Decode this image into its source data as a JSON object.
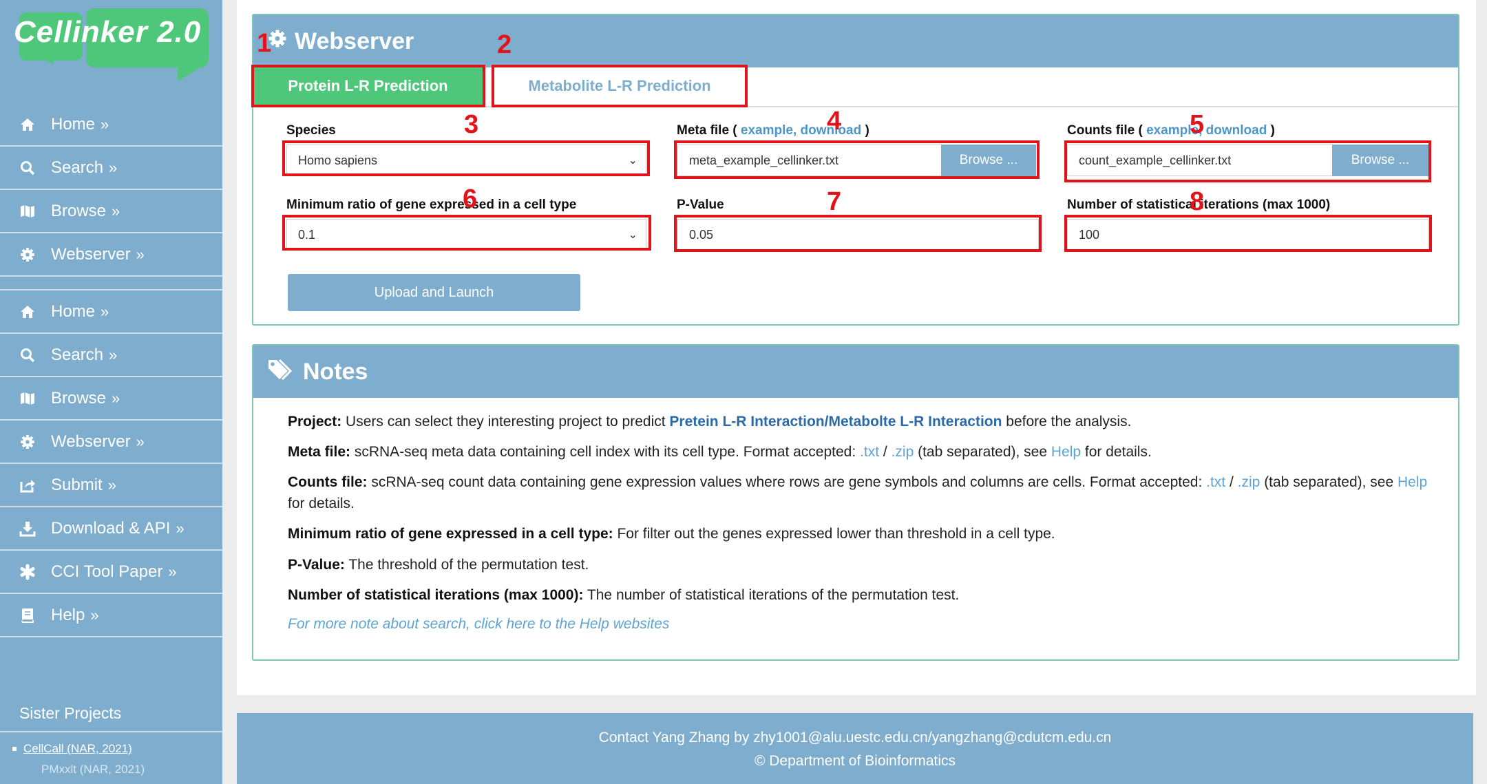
{
  "logo": {
    "text": "Cellinker 2.0"
  },
  "nav": [
    {
      "label": "Home",
      "icon": "home-icon"
    },
    {
      "label": "Search",
      "icon": "search-icon"
    },
    {
      "label": "Browse",
      "icon": "map-icon"
    },
    {
      "label": "Webserver",
      "icon": "gear-icon"
    },
    {
      "label": "Home",
      "icon": "home-icon"
    },
    {
      "label": "Search",
      "icon": "search-icon"
    },
    {
      "label": "Browse",
      "icon": "map-icon"
    },
    {
      "label": "Webserver",
      "icon": "gear-icon"
    },
    {
      "label": "Submit",
      "icon": "share-icon"
    },
    {
      "label": "Download & API",
      "icon": "download-icon"
    },
    {
      "label": "CCI Tool Paper",
      "icon": "asterisk-icon"
    },
    {
      "label": "Help",
      "icon": "book-icon"
    }
  ],
  "nav_chevron": "»",
  "sister": {
    "title": "Sister Projects",
    "link": "CellCall (NAR, 2021)",
    "cut": "PMxxlt (NAR, 2021)"
  },
  "webserver": {
    "title": "Webserver",
    "tabs": {
      "protein": "Protein L-R Prediction",
      "metabolite": "Metabolite L-R Prediction"
    },
    "species": {
      "label": "Species",
      "value": "Homo sapiens"
    },
    "meta": {
      "label": "Meta file (",
      "example": "example,",
      "download": "download",
      "close": ")",
      "value": "meta_example_cellinker.txt",
      "browse": "Browse ..."
    },
    "counts": {
      "label": "Counts file (",
      "example": "example,",
      "download": "download",
      "close": ")",
      "value": "count_example_cellinker.txt",
      "browse": "Browse ..."
    },
    "min_ratio": {
      "label": "Minimum ratio of gene expressed in a cell type",
      "value": "0.1"
    },
    "pvalue": {
      "label": "P-Value",
      "value": "0.05"
    },
    "iterations": {
      "label": "Number of statistical iterations (max 1000)",
      "value": "100"
    },
    "launch": "Upload and Launch"
  },
  "annotations": [
    "1",
    "2",
    "3",
    "4",
    "5",
    "6",
    "7",
    "8"
  ],
  "annotation_color": "#e1141c",
  "notes": {
    "title": "Notes",
    "project": {
      "k": "Project:",
      "t1": " Users can select they interesting project to predict ",
      "hl": "Pretein L-R Interaction/Metabolte L-R Interaction",
      "t2": " before the analysis."
    },
    "meta": {
      "k": "Meta file:",
      "t1": " scRNA-seq meta data containing cell index with its cell type. Format accepted: ",
      "txt": ".txt",
      "sep": " / ",
      "zip": ".zip",
      "t2": " (tab separated), see ",
      "help": "Help",
      "t3": " for details."
    },
    "counts": {
      "k": "Counts file:",
      "t1": " scRNA-seq count data containing gene expression values where rows are gene symbols and columns are cells. Format accepted: ",
      "txt": ".txt",
      "sep": " / ",
      "zip": ".zip",
      "t2": " (tab separated), see ",
      "help": "Help",
      "t3": " for details."
    },
    "minratio": {
      "k": "Minimum ratio of gene expressed in a cell type:",
      "t": " For filter out the genes expressed lower than threshold in a cell type."
    },
    "pvalue": {
      "k": "P-Value:",
      "t": " The threshold of the permutation test."
    },
    "iter": {
      "k": "Number of statistical iterations (max 1000):",
      "t": " The number of statistical iterations of the permutation test."
    },
    "more": "For more note about search, click here to the Help websites"
  },
  "footer": {
    "line1": "Contact Yang Zhang by  zhy1001@alu.uestc.edu.cn/yangzhang@cdutcm.edu.cn",
    "line2": "© Department of Bioinformatics"
  },
  "colors": {
    "sidebar": "#7fadcd",
    "accent_green": "#4fc77b",
    "link": "#5ea3d3",
    "panel_border": "#7fc6b6"
  }
}
